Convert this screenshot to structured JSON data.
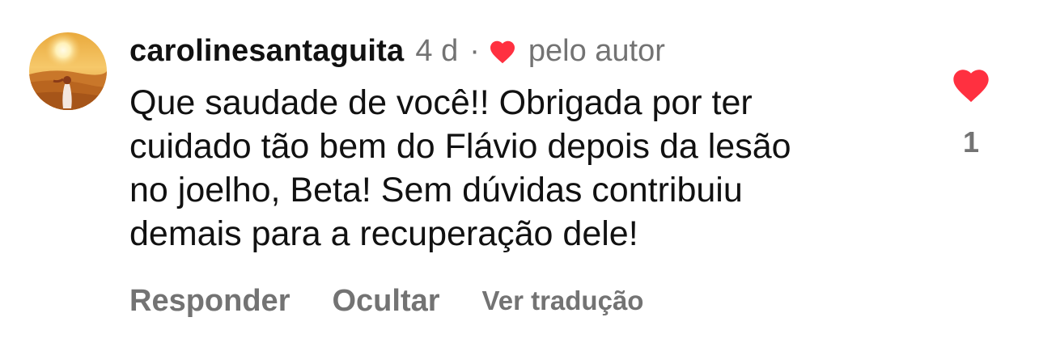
{
  "comment": {
    "username": "carolinesantaguita",
    "time_ago": "4 d",
    "separator": "·",
    "liked_by_author": "pelo autor",
    "text_lines": [
      "Que saudade de você!! Obrigada por ter",
      "cuidado tão bem do Flávio depois da lesão",
      "no joelho, Beta! Sem dúvidas contribuiu",
      "demais para a recuperação dele!"
    ],
    "like_count": "1",
    "actions": {
      "reply": "Responder",
      "hide": "Ocultar",
      "translate": "Ver tradução"
    }
  },
  "icons": {
    "author_like": "heart-filled-icon",
    "like_button": "heart-filled-icon"
  },
  "colors": {
    "heart_red": "#ff3040",
    "secondary_text": "#737373",
    "primary_text": "#111111"
  }
}
